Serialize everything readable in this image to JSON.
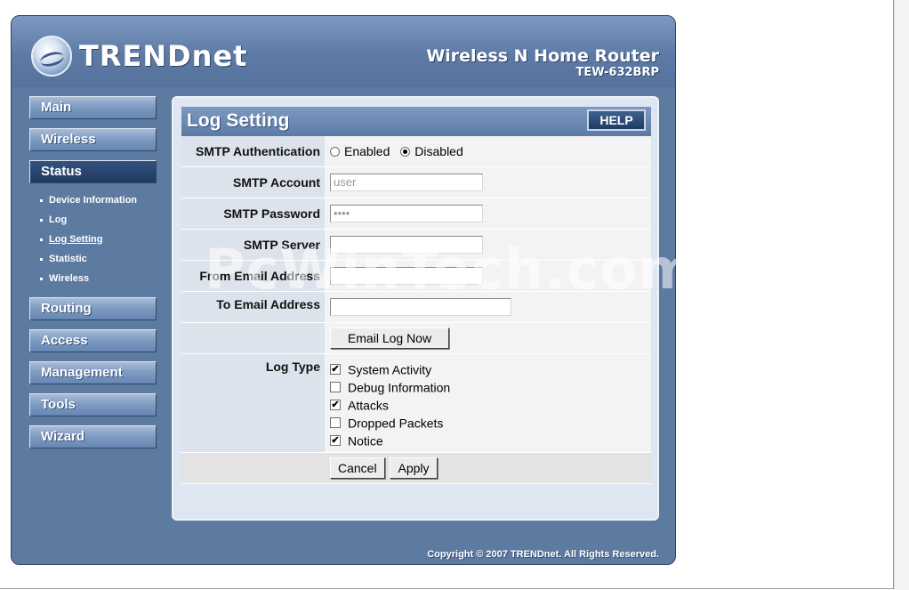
{
  "header": {
    "brand": "TRENDnet",
    "product_name": "Wireless N Home Router",
    "model": "TEW-632BRP"
  },
  "sidebar": {
    "main": "Main",
    "wireless": "Wireless",
    "status": "Status",
    "status_sub": [
      {
        "label": "Device Information"
      },
      {
        "label": "Log"
      },
      {
        "label": "Log Setting"
      },
      {
        "label": "Statistic"
      },
      {
        "label": "Wireless"
      }
    ],
    "routing": "Routing",
    "access": "Access",
    "management": "Management",
    "tools": "Tools",
    "wizard": "Wizard"
  },
  "panel": {
    "title": "Log Setting",
    "help": "HELP"
  },
  "form": {
    "smtp_auth_label": "SMTP Authentication",
    "smtp_auth_enabled": "Enabled",
    "smtp_auth_disabled": "Disabled",
    "smtp_auth_value": "Disabled",
    "smtp_account_label": "SMTP Account",
    "smtp_account_value": "user",
    "smtp_password_label": "SMTP Password",
    "smtp_password_value": "••••",
    "smtp_server_label": "SMTP Server",
    "smtp_server_value": "",
    "from_email_label": "From Email Address",
    "from_email_value": "",
    "to_email_label": "To Email Address",
    "to_email_value": "",
    "email_log_now": "Email Log Now",
    "log_type_label": "Log Type",
    "log_types": [
      {
        "label": "System Activity",
        "checked": "✔"
      },
      {
        "label": "Debug Information",
        "checked": ""
      },
      {
        "label": "Attacks",
        "checked": "✔"
      },
      {
        "label": "Dropped Packets",
        "checked": ""
      },
      {
        "label": "Notice",
        "checked": "✔"
      }
    ],
    "cancel": "Cancel",
    "apply": "Apply"
  },
  "footer": {
    "copyright": "Copyright © 2007 TRENDnet. All Rights Reserved."
  },
  "watermark": "PcWinTech.com"
}
